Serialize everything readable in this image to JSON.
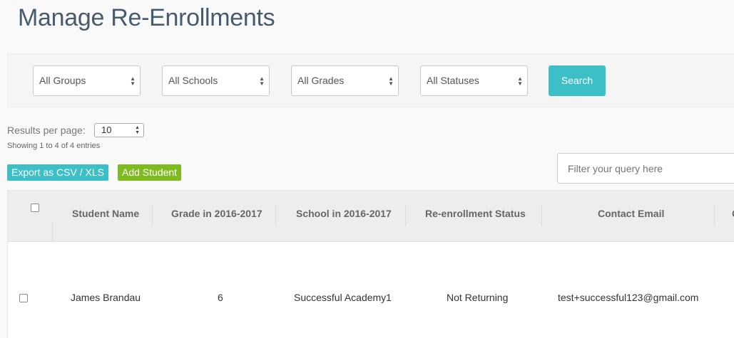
{
  "page": {
    "title": "Manage Re-Enrollments"
  },
  "filters": {
    "groups": "All Groups",
    "schools": "All Schools",
    "grades": "All Grades",
    "statuses": "All Statuses",
    "search_label": "Search"
  },
  "pagination": {
    "results_label": "Results per page:",
    "per_page": "10",
    "showing": "Showing 1 to 4 of 4 entries"
  },
  "actions": {
    "export_label": "Export as CSV / XLS",
    "add_label": "Add Student",
    "filter_placeholder": "Filter your query here"
  },
  "table": {
    "headers": [
      "Student Name",
      "Grade in 2016-2017",
      "School in 2016-2017",
      "Re-enrollment Status",
      "Contact Email",
      "C"
    ],
    "rows": [
      [
        "James Brandau",
        "6",
        "Successful Academy1",
        "Not Returning",
        "test+successful123@gmail.com"
      ]
    ]
  },
  "colors": {
    "accent": "#3dbfc7",
    "add_button": "#7dbb1e",
    "title": "#485b6e"
  }
}
